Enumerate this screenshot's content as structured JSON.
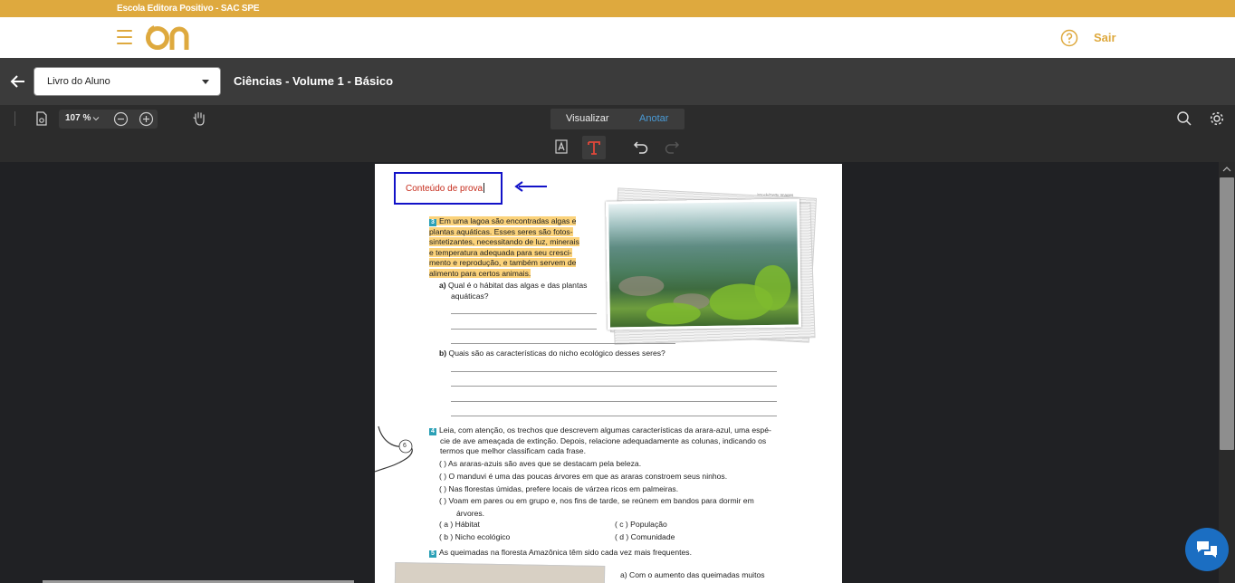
{
  "top_banner": {
    "text": "Escola Editora Positivo - SAC SPE"
  },
  "header": {
    "logo": "on-logo",
    "help_icon": "question-icon",
    "logout_label": "Sair"
  },
  "doc_bar": {
    "book_select": {
      "value": "Livro do Aluno"
    },
    "title": "Ciências - Volume 1 - Básico"
  },
  "toolbar": {
    "zoom": "107 %",
    "modes": {
      "view": "Visualizar",
      "annotate": "Anotar",
      "active": "Anotar"
    }
  },
  "annotation_toolbar": {
    "tools": [
      "highlight-icon",
      "text-icon",
      "undo-icon",
      "redo-icon"
    ],
    "active": "text-icon"
  },
  "page": {
    "note_text": "Conteúdo de prova",
    "photo_credit": "iStock/Getty Images",
    "q3": {
      "number": "3",
      "lines": [
        "Em uma lagoa são encontradas algas e",
        "plantas aquáticas. Esses seres são fotos-",
        "sintetizantes, necessitando de luz, minerais",
        "e temperatura adequada para seu cresci-",
        "mento e reprodução, e também servem de",
        "alimento para certos animais."
      ],
      "a_label": "a)",
      "a_lines": [
        "Qual é o hábitat das algas e das plantas",
        "aquáticas?"
      ],
      "b_label": "b)",
      "b_text": "Quais são as características do nicho ecológico desses seres?"
    },
    "q4": {
      "number": "4",
      "lines": [
        "Leia, com atenção, os trechos que descrevem algumas características da arara-azul, uma espé-",
        "cie de ave ameaçada de extinção. Depois, relacione adequadamente as colunas, indicando os",
        "termos que melhor classificam cada frase."
      ],
      "items": [
        "(    )  As araras-azuis são aves que se destacam pela beleza.",
        "(    )  O manduvi é uma das poucas árvores em que as araras constroem seus ninhos.",
        "(    )  Nas florestas úmidas, prefere locais de várzea ricos em palmeiras.",
        "(    )  Voam em pares ou em grupo e, nos fins de tarde, se reúnem em bandos para dormir em",
        "árvores."
      ],
      "options_left": [
        "( a ) Hábitat",
        "( b ) Nicho ecológico"
      ],
      "options_right": [
        "( c ) População",
        "( d ) Comunidade"
      ]
    },
    "q5": {
      "number": "5",
      "text": "As queimadas na floresta Amazônica têm sido cada vez mais frequentes.",
      "a_text": "a) Com o aumento das queimadas muitos"
    },
    "margin_page_number": "6"
  },
  "chat_button": {
    "icon": "chat-icon"
  }
}
